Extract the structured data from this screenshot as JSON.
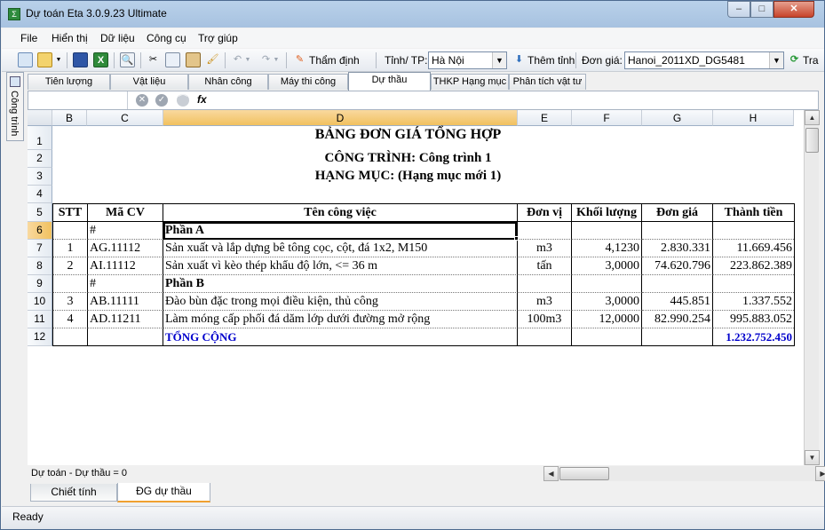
{
  "window": {
    "title": "Dự toán Eta 3.0.9.23 Ultimate",
    "min_label": "–",
    "max_label": "□",
    "close_label": "✕"
  },
  "menu": [
    "File",
    "Hiển thị",
    "Dữ liệu",
    "Công cụ",
    "Trợ giúp"
  ],
  "toolbar": {
    "tham_dinh": "Thẩm định",
    "tinh_label": "Tỉnh/ TP:",
    "tinh_value": "Hà Nội",
    "them_tinh": "Thêm tỉnh",
    "don_gia_label": "Đơn giá:",
    "don_gia_value": "Hanoi_2011XD_DG5481",
    "tra": "Tra"
  },
  "side_tab": "Công trình",
  "sheet_tabs": [
    "Tiên lượng",
    "Vật liệu",
    "Nhân công",
    "Máy thi công",
    "Dự thầu",
    "THKP Hạng mục",
    "Phân tích vật tư"
  ],
  "active_sheet_tab": "Dự thầu",
  "formula_bar": {
    "fx": "fx"
  },
  "columns": [
    "B",
    "C",
    "D",
    "E",
    "F",
    "G",
    "H"
  ],
  "selected_column": "D",
  "rows": [
    "1",
    "2",
    "3",
    "4",
    "5",
    "6",
    "7",
    "8",
    "9",
    "10",
    "11",
    "12"
  ],
  "selected_row": "6",
  "sheet": {
    "title": "BẢNG ĐƠN GIÁ TỔNG HỢP",
    "cong_trinh": "CÔNG TRÌNH: Công trình 1",
    "hang_muc": "HẠNG MỤC: (Hạng mục mới 1)",
    "headers": [
      "STT",
      "Mã CV",
      "Tên công việc",
      "Đơn vị",
      "Khối lượng",
      "Đơn giá",
      "Thành tiền"
    ],
    "data_rows": [
      [
        "",
        "#",
        "Phần A",
        "",
        "",
        "",
        ""
      ],
      [
        "1",
        "AG.11112",
        "Sản xuất và lắp dựng bê tông cọc, cột, đá 1x2, M150",
        "m3",
        "4,1230",
        "2.830.331",
        "11.669.456"
      ],
      [
        "2",
        "AI.11112",
        "Sản xuất vì kèo thép khẩu độ lớn, <= 36 m",
        "tấn",
        "3,0000",
        "74.620.796",
        "223.862.389"
      ],
      [
        "",
        "#",
        "Phần B",
        "",
        "",
        "",
        ""
      ],
      [
        "3",
        "AB.11111",
        "Đào bùn đặc trong mọi điều kiện, thủ công",
        "m3",
        "3,0000",
        "445.851",
        "1.337.552"
      ],
      [
        "4",
        "AD.11211",
        "Làm móng cấp phối đá dăm lớp dưới đường mở rộng",
        "100m3",
        "12,0000",
        "82.990.254",
        "995.883.052"
      ],
      [
        "",
        "",
        "TỔNG CỘNG",
        "",
        "",
        "",
        "1.232.752.450"
      ]
    ]
  },
  "sheet_status": "Dự toán - Dự thầu = 0",
  "bottom_tabs": [
    "Chiết tính",
    "ĐG dự thầu"
  ],
  "active_bottom_tab": "ĐG dự thầu",
  "status": "Ready"
}
